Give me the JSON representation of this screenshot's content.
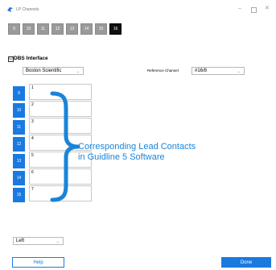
{
  "window": {
    "title": "LP Channels",
    "app_icon": "bird-logo-icon"
  },
  "channel_tabs": [
    {
      "label": "9"
    },
    {
      "label": "10"
    },
    {
      "label": "11"
    },
    {
      "label": "12"
    },
    {
      "label": "13"
    },
    {
      "label": "14"
    },
    {
      "label": "15"
    },
    {
      "label": "16",
      "active": true
    }
  ],
  "dbs_interface": {
    "checked": true,
    "check_mark": "☑",
    "title": "DBS Interface",
    "manufacturer": "Boston Scientific",
    "reference_label": "Reference Channel",
    "reference_value": "#16/8"
  },
  "rows": [
    {
      "channel": "9",
      "contact": "1"
    },
    {
      "channel": "10",
      "contact": "2"
    },
    {
      "channel": "11",
      "contact": "3"
    },
    {
      "channel": "12",
      "contact": "4"
    },
    {
      "channel": "13",
      "contact": "5"
    },
    {
      "channel": "14",
      "contact": "6"
    },
    {
      "channel": "15",
      "contact": "7"
    }
  ],
  "annotation": {
    "line1": "Corresponding Lead Contacts",
    "line2": "in Guidline 5 Software",
    "color": "#1a84d8"
  },
  "side_select": "Left",
  "buttons": {
    "help": "Help",
    "done": "Done"
  },
  "colors": {
    "accent": "#1a7ae0",
    "tab": "#9a9a9a",
    "tab_active": "#111111"
  }
}
